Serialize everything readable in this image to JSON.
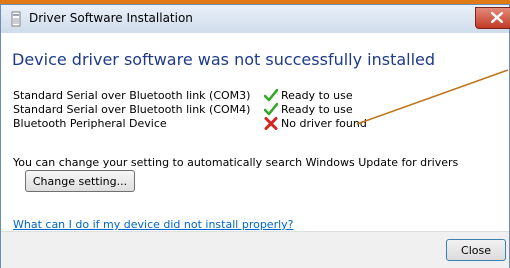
{
  "window": {
    "title": "Driver Software Installation",
    "heading": "Device driver software was not successfully installed"
  },
  "devices": [
    {
      "name": "Standard Serial over Bluetooth link (COM3)",
      "status": "Ready to use",
      "status_icon": "green-check-icon"
    },
    {
      "name": "Standard Serial over Bluetooth link (COM4)",
      "status": "Ready to use",
      "status_icon": "green-check-icon"
    },
    {
      "name": "Bluetooth Peripheral Device",
      "status": "No driver found",
      "status_icon": "red-x-icon"
    }
  ],
  "update_info": "You can change your setting to automatically search Windows Update for drivers",
  "change_setting_label": "Change setting...",
  "help_link": "What can I do if my device did not install properly?",
  "close_label": "Close",
  "colors": {
    "heading": "#1e3b8a",
    "link": "#0066cc",
    "annotation_line": "#c0731b",
    "accent_strip": "#e07a17"
  }
}
